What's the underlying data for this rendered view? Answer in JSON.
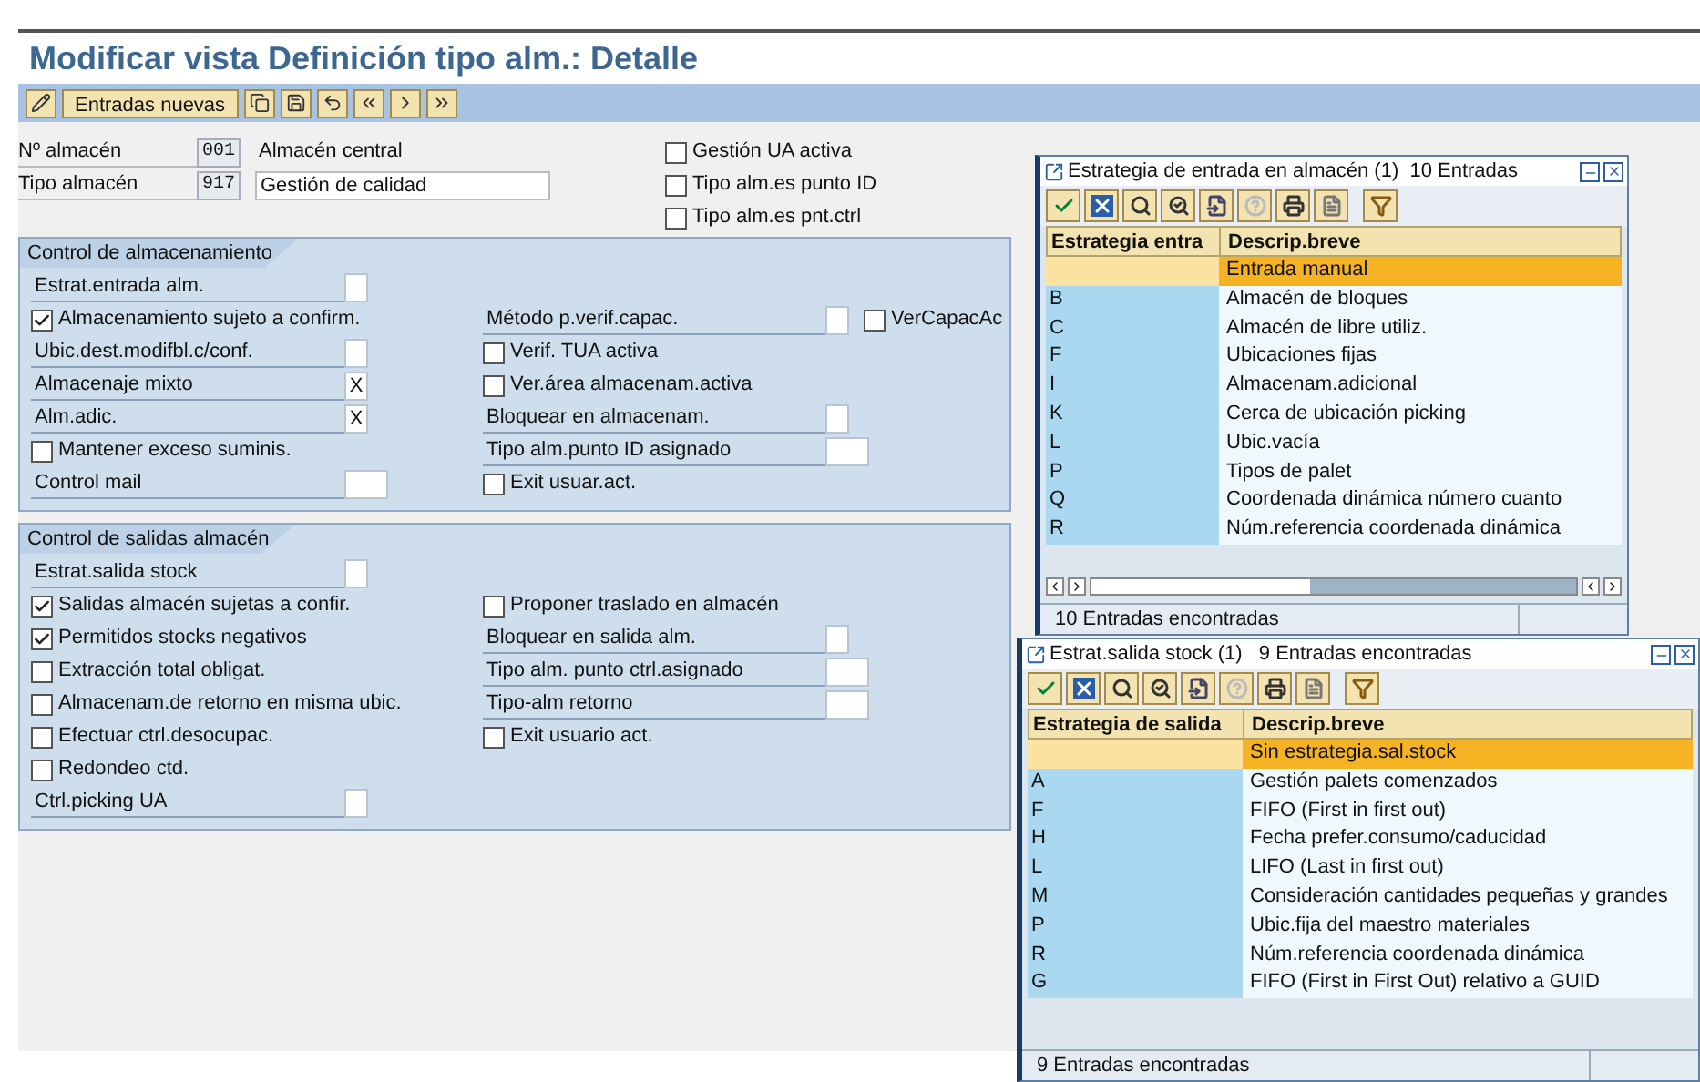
{
  "title": "Modificar vista Definición tipo alm.: Detalle",
  "toolbar": {
    "buttons": [
      {
        "kind": "icon"
      },
      {
        "kind": "text",
        "label": "Entradas nuevas"
      },
      {
        "kind": "icon"
      },
      {
        "kind": "icon"
      },
      {
        "kind": "icon"
      },
      {
        "kind": "icon"
      },
      {
        "kind": "icon"
      },
      {
        "kind": "icon"
      }
    ]
  },
  "header": {
    "fields": [
      {
        "label": "Nº almacén",
        "value": "001",
        "description": "Almacén central",
        "description_boxed": false
      },
      {
        "label": "Tipo almacén",
        "value": "917",
        "description": "Gestión de calidad",
        "description_boxed": true
      }
    ],
    "checkboxes": [
      {
        "label": "Gestión UA activa",
        "checked": false
      },
      {
        "label": "Tipo alm.es punto ID",
        "checked": false
      },
      {
        "label": "Tipo alm.es pnt.ctrl",
        "checked": false
      }
    ]
  },
  "sections": [
    {
      "title": "Control de almacenamiento",
      "rows": [
        {
          "left": {
            "kind": "field",
            "label": "Estrat.entrada alm.",
            "wide": false
          }
        },
        {
          "left": {
            "kind": "checkbox",
            "label": "Almacenamiento sujeto a confirm.",
            "checked": true
          },
          "right": {
            "kind": "field",
            "label": "Método p.verif.capac.",
            "wide": false,
            "side_checkbox": {
              "label": "VerCapacAc",
              "checked": false
            }
          }
        },
        {
          "left": {
            "kind": "field",
            "label": "Ubic.dest.modifbl.c/conf.",
            "wide": false
          },
          "right": {
            "kind": "checkbox",
            "label": "Verif. TUA activa",
            "checked": false
          }
        },
        {
          "left": {
            "kind": "field",
            "label": "Almacenaje mixto",
            "value": "X",
            "wide": false
          },
          "right": {
            "kind": "checkbox",
            "label": "Ver.área almacenam.activa",
            "checked": false
          }
        },
        {
          "left": {
            "kind": "field",
            "label": "Alm.adic.",
            "value": "X",
            "wide": false
          },
          "right": {
            "kind": "field",
            "label": "Bloquear en almacenam.",
            "wide": false
          }
        },
        {
          "left": {
            "kind": "checkbox",
            "label": "Mantener exceso suminis.",
            "checked": false
          },
          "right": {
            "kind": "field",
            "label": "Tipo alm.punto ID asignado",
            "wide": true
          }
        },
        {
          "left": {
            "kind": "field",
            "label": "Control mail",
            "wide": true
          },
          "right": {
            "kind": "checkbox",
            "label": "Exit usuar.act.",
            "checked": false
          }
        }
      ]
    },
    {
      "title": "Control de salidas almacén",
      "rows": [
        {
          "left": {
            "kind": "field",
            "label": "Estrat.salida stock",
            "wide": false
          }
        },
        {
          "left": {
            "kind": "checkbox",
            "label": "Salidas almacén sujetas a confir.",
            "checked": true
          },
          "right": {
            "kind": "checkbox",
            "label": "Proponer traslado en almacén",
            "checked": false
          }
        },
        {
          "left": {
            "kind": "checkbox",
            "label": "Permitidos stocks negativos",
            "checked": true
          },
          "right": {
            "kind": "field",
            "label": "Bloquear en salida alm.",
            "wide": false
          }
        },
        {
          "left": {
            "kind": "checkbox",
            "label": "Extracción total obligat.",
            "checked": false
          },
          "right": {
            "kind": "field",
            "label": "Tipo alm. punto ctrl.asignado",
            "wide": true
          }
        },
        {
          "left": {
            "kind": "checkbox",
            "label": "Almacenam.de retorno en misma ubic.",
            "checked": false
          },
          "right": {
            "kind": "field",
            "label": "Tipo-alm retorno",
            "wide": true
          }
        },
        {
          "left": {
            "kind": "checkbox",
            "label": "Efectuar ctrl.desocupac.",
            "checked": false
          },
          "right": {
            "kind": "checkbox",
            "label": "Exit usuario act.",
            "checked": false
          }
        },
        {
          "left": {
            "kind": "checkbox",
            "label": "Redondeo ctd.",
            "checked": false
          }
        },
        {
          "left": {
            "kind": "field",
            "label": "Ctrl.picking UA",
            "wide": false
          }
        }
      ]
    }
  ],
  "popups": [
    {
      "title": "Estrategia de entrada en almacén (1)  10 Entradas",
      "columns": [
        "Estrategia entra",
        "Descrip.breve"
      ],
      "horizontal_scrollbar": true,
      "rows": [
        {
          "description": "Entrada manual",
          "selected": true
        },
        {
          "code": "B",
          "description": "Almacén de bloques",
          "selected": false
        },
        {
          "code": "C",
          "description": "Almacén de libre utiliz.",
          "selected": false
        },
        {
          "code": "F",
          "description": "Ubicaciones fijas",
          "selected": false
        },
        {
          "code": "I",
          "description": "Almacenam.adicional",
          "selected": false
        },
        {
          "code": "K",
          "description": "Cerca de ubicación picking",
          "selected": false
        },
        {
          "code": "L",
          "description": "Ubic.vacía",
          "selected": false
        },
        {
          "code": "P",
          "description": "Tipos de palet",
          "selected": false
        },
        {
          "code": "Q",
          "description": "Coordenada dinámica número cuanto",
          "selected": false
        },
        {
          "code": "R",
          "description": "Núm.referencia coordenada dinámica",
          "selected": false
        }
      ],
      "status": "10 Entradas encontradas"
    },
    {
      "title": "Estrat.salida stock (1)   9 Entradas encontradas",
      "columns": [
        "Estrategia de salida",
        "Descrip.breve"
      ],
      "horizontal_scrollbar": false,
      "rows": [
        {
          "description": "Sin estrategia.sal.stock",
          "selected": true
        },
        {
          "code": "A",
          "description": "Gestión palets comenzados",
          "selected": false
        },
        {
          "code": "F",
          "description": "FIFO (First in first out)",
          "selected": false
        },
        {
          "code": "H",
          "description": "Fecha prefer.consumo/caducidad",
          "selected": false
        },
        {
          "code": "L",
          "description": "LIFO (Last in first out)",
          "selected": false
        },
        {
          "code": "M",
          "description": "Consideración cantidades pequeñas y grandes",
          "selected": false
        },
        {
          "code": "P",
          "description": "Ubic.fija del maestro materiales",
          "selected": false
        },
        {
          "code": "R",
          "description": "Núm.referencia coordenada dinámica",
          "selected": false
        },
        {
          "code": "G",
          "description": "FIFO (First in First Out) relativo a GUID",
          "selected": false
        }
      ],
      "status": "9 Entradas encontradas"
    }
  ]
}
